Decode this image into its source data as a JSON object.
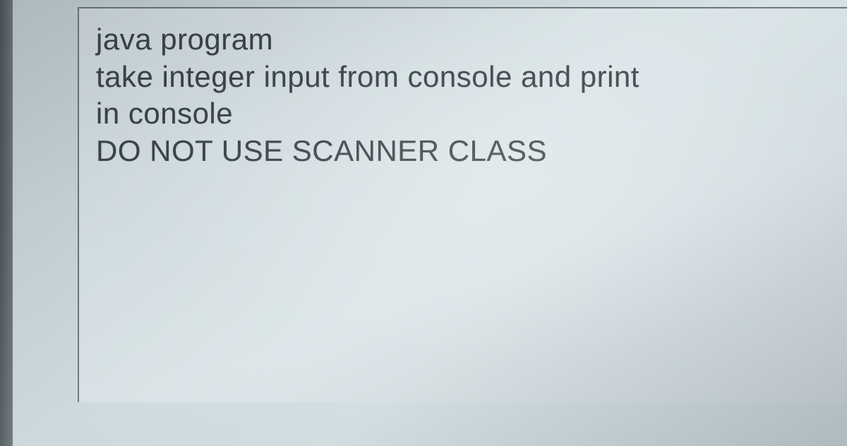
{
  "content": {
    "line1": "java program",
    "line2": "take  integer input from console and print",
    "line3": "in console",
    "line4": "DO NOT USE SCANNER CLASS"
  }
}
